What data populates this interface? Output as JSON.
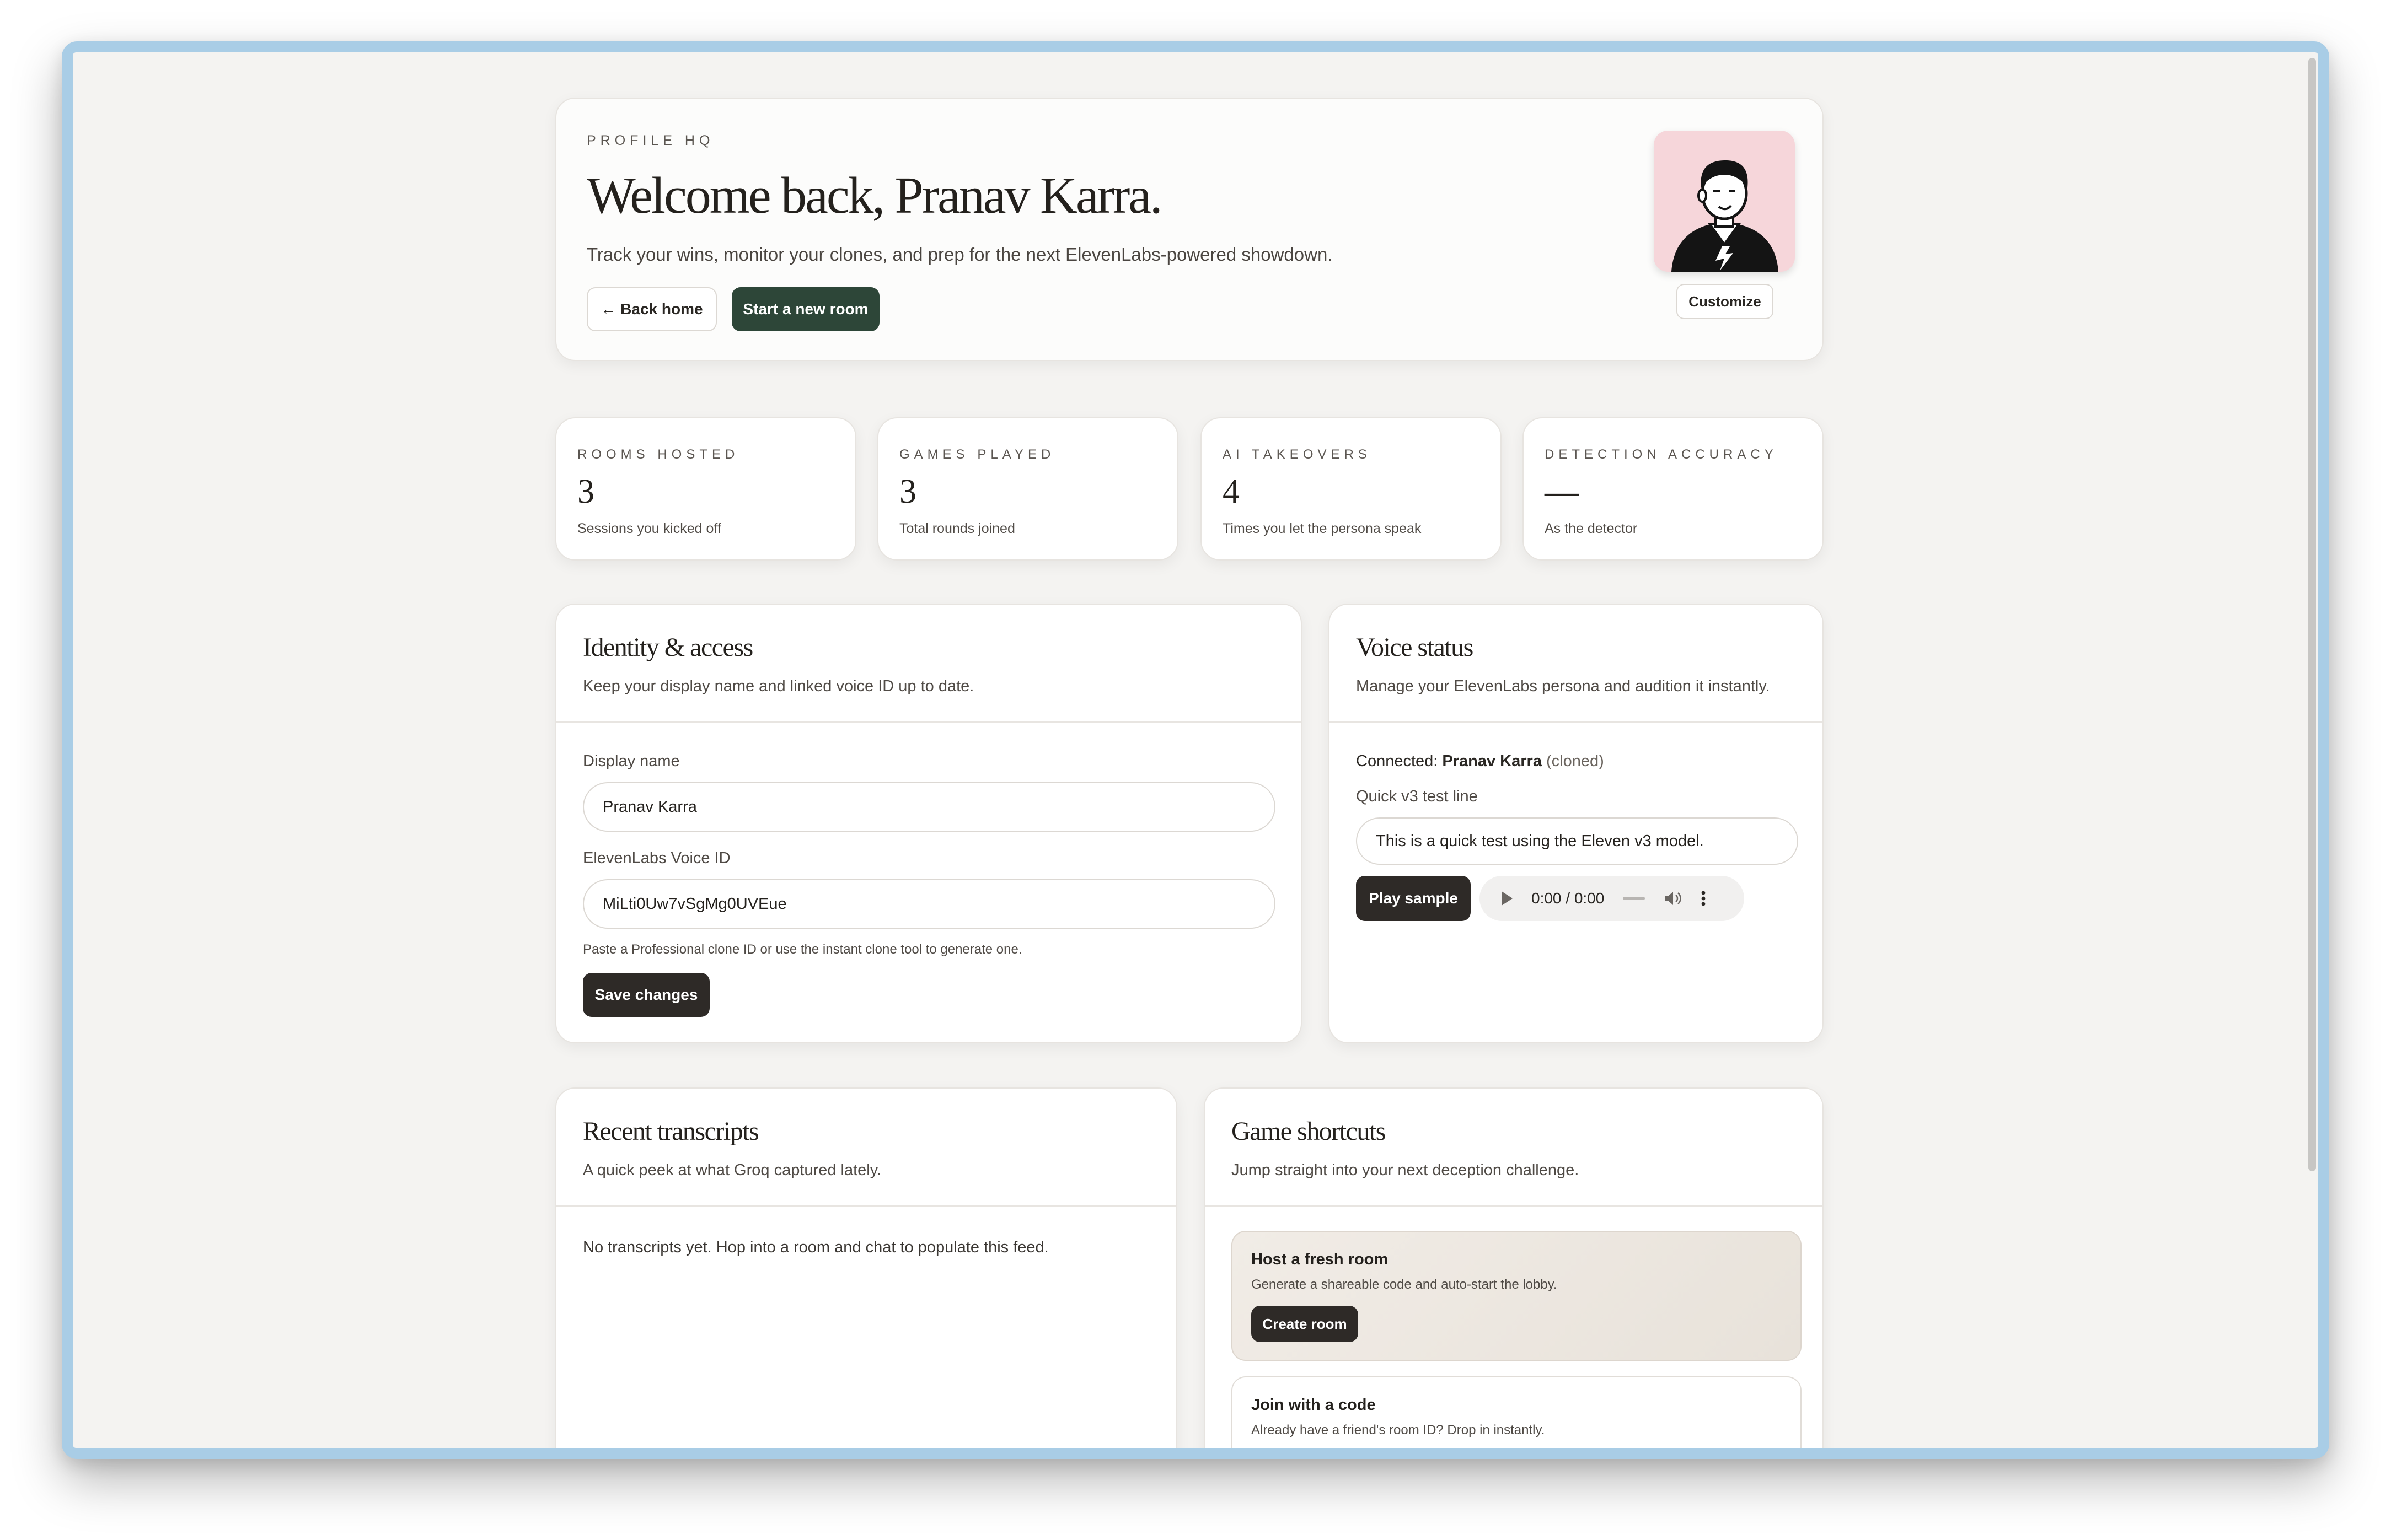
{
  "hero": {
    "eyebrow": "PROFILE HQ",
    "title": "Welcome back, Pranav Karra.",
    "subtitle": "Track your wins, monitor your clones, and prep for the next ElevenLabs-powered showdown.",
    "back_label": "← Back home",
    "new_room_label": "Start a new room",
    "customize_label": "Customize",
    "avatar_bg": "#f6d6da"
  },
  "stats": [
    {
      "label": "ROOMS HOSTED",
      "value": "3",
      "caption": "Sessions you kicked off"
    },
    {
      "label": "GAMES PLAYED",
      "value": "3",
      "caption": "Total rounds joined"
    },
    {
      "label": "AI TAKEOVERS",
      "value": "4",
      "caption": "Times you let the persona speak"
    },
    {
      "label": "DETECTION ACCURACY",
      "value": "—",
      "caption": "As the detector"
    }
  ],
  "identity": {
    "title": "Identity & access",
    "subtitle": "Keep your display name and linked voice ID up to date.",
    "display_name_label": "Display name",
    "display_name_value": "Pranav Karra",
    "voice_id_label": "ElevenLabs Voice ID",
    "voice_id_value": "MiLti0Uw7vSgMg0UVEue",
    "hint": "Paste a Professional clone ID or use the instant clone tool to generate one.",
    "save_label": "Save changes"
  },
  "voice": {
    "title": "Voice status",
    "subtitle": "Manage your ElevenLabs persona and audition it instantly.",
    "connected_prefix": "Connected: ",
    "connected_name": "Pranav Karra",
    "connected_suffix": " (cloned)",
    "test_label": "Quick v3 test line",
    "test_value": "This is a quick test using the Eleven v3 model.",
    "play_label": "Play sample",
    "audio_time": "0:00 / 0:00"
  },
  "transcripts": {
    "title": "Recent transcripts",
    "subtitle": "A quick peek at what Groq captured lately.",
    "empty": "No transcripts yet. Hop into a room and chat to populate this feed."
  },
  "shortcuts": {
    "title": "Game shortcuts",
    "subtitle": "Jump straight into your next deception challenge.",
    "host_title": "Host a fresh room",
    "host_sub": "Generate a shareable code and auto-start the lobby.",
    "create_label": "Create room",
    "join_title": "Join with a code",
    "join_sub": "Already have a friend's room ID? Drop in instantly."
  },
  "colors": {
    "accent_green": "#2d4638",
    "button_dark": "#2e2a27",
    "page_bg": "#f4f3f1",
    "window_frame": "#a9cde6"
  }
}
